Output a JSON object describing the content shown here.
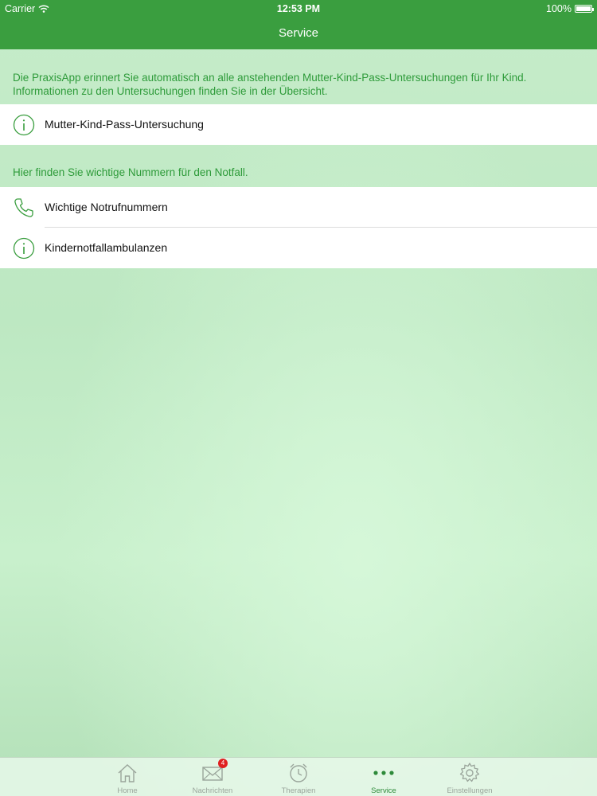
{
  "status_bar": {
    "carrier": "Carrier",
    "time": "12:53 PM",
    "battery": "100%"
  },
  "nav": {
    "title": "Service"
  },
  "sections": [
    {
      "description": "Die PraxisApp erinnert Sie automatisch an alle anstehenden Mutter-Kind-Pass-Untersuchungen für Ihr Kind. Informationen zu den Untersuchungen finden Sie in der Übersicht.",
      "items": [
        {
          "label": "Mutter-Kind-Pass-Untersuchung",
          "icon": "info-icon"
        }
      ]
    },
    {
      "description": "Hier finden Sie wichtige Nummern für den Notfall.",
      "items": [
        {
          "label": "Wichtige Notrufnummern",
          "icon": "phone-icon"
        },
        {
          "label": "Kindernotfallambulanzen",
          "icon": "info-icon"
        }
      ]
    }
  ],
  "tabbar": {
    "tabs": [
      {
        "label": "Home",
        "icon": "home-icon"
      },
      {
        "label": "Nachrichten",
        "icon": "envelope-icon",
        "badge": "4"
      },
      {
        "label": "Therapien",
        "icon": "alarm-clock-icon"
      },
      {
        "label": "Service",
        "icon": "more-dots-icon",
        "active": true
      },
      {
        "label": "Einstellungen",
        "icon": "gear-icon"
      }
    ]
  },
  "colors": {
    "accent": "#3a9e3f",
    "section_text": "#2e9b3a",
    "badge": "#e02020"
  }
}
